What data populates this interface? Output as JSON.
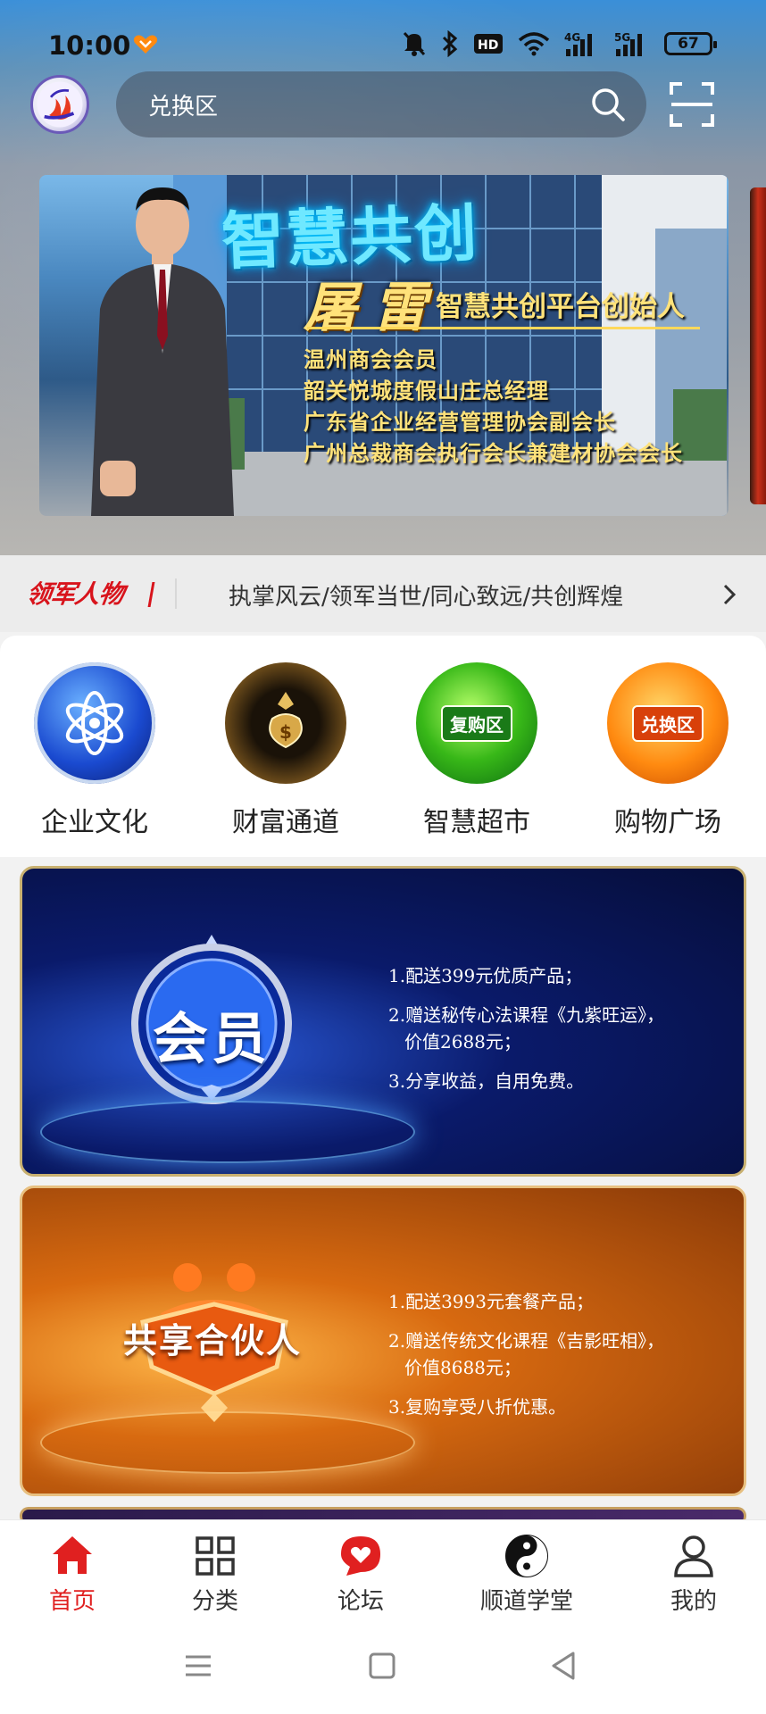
{
  "status_bar": {
    "time": "10:00",
    "battery": "67",
    "icons": [
      "mute-icon",
      "bluetooth-icon",
      "hd-icon",
      "wifi-icon",
      "4g-signal-icon",
      "5g-signal-icon",
      "battery-icon"
    ]
  },
  "header": {
    "search_placeholder": "兑换区"
  },
  "banner": {
    "title": "智慧共创",
    "name": "屠雷",
    "role": "智慧共创平台创始人",
    "lines": [
      "温州商会会员",
      "韶关悦城度假山庄总经理",
      "广东省企业经营管理协会副会长",
      "广州总裁商会执行会长兼建材协会会长"
    ]
  },
  "leader_strip": {
    "logo": "领军人物",
    "text": "执掌风云/领军当世/同心致远/共创辉煌"
  },
  "grid": {
    "items": [
      {
        "label": "企业文化",
        "icon": "atom-emblem-icon"
      },
      {
        "label": "财富通道",
        "icon": "money-bag-emblem-icon"
      },
      {
        "label": "智慧超市",
        "icon": "repurchase-emblem-icon",
        "badge": "复购区"
      },
      {
        "label": "购物广场",
        "icon": "exchange-emblem-icon",
        "badge": "兑换区"
      }
    ]
  },
  "cards": {
    "member": {
      "emblem": "会员",
      "items": [
        "1.配送399元优质产品；",
        "2.赠送秘传心法课程《九紫旺运》，",
        "价值2688元；",
        "3.分享收益，自用免费。"
      ]
    },
    "partner": {
      "emblem": "共享合伙人",
      "items": [
        "1.配送3993元套餐产品；",
        "2.赠送传统文化课程《吉影旺相》，",
        "价值8688元；",
        "3.复购享受八折优惠。"
      ]
    }
  },
  "bottom_nav": {
    "items": [
      {
        "label": "首页",
        "active": true
      },
      {
        "label": "分类"
      },
      {
        "label": "论坛"
      },
      {
        "label": "顺道学堂"
      },
      {
        "label": "我的"
      }
    ]
  },
  "colors": {
    "accent": "#e02020",
    "leader_red": "#d8141c"
  }
}
